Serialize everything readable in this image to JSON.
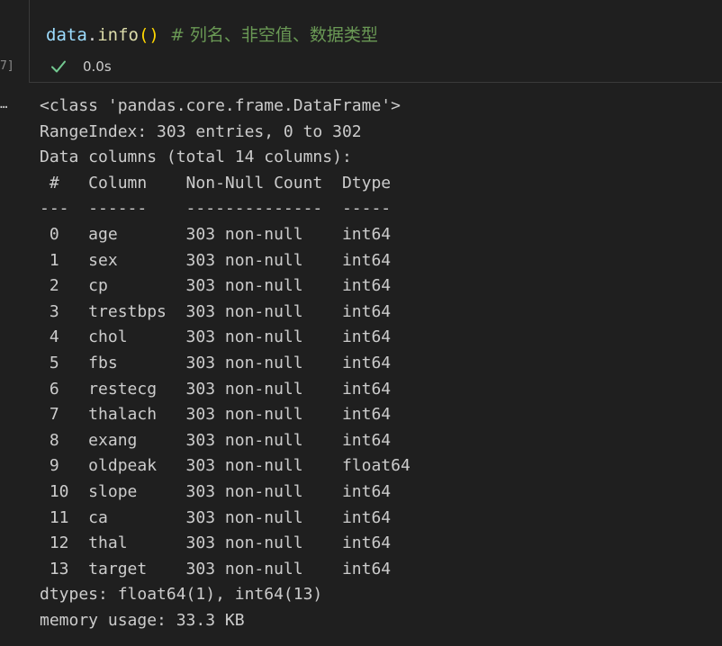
{
  "cell": {
    "execution_count": "7]",
    "code": {
      "var": "data",
      "dot": ".",
      "fn": "info",
      "parens": "()",
      "comment": "  # 列名、非空值、数据类型"
    },
    "status": {
      "icon": "check-icon",
      "duration": "0.0s",
      "success_color": "#73c991"
    }
  },
  "output": {
    "marker": "…",
    "lines": [
      "<class 'pandas.core.frame.DataFrame'>",
      "RangeIndex: 303 entries, 0 to 302",
      "Data columns (total 14 columns):",
      " #   Column    Non-Null Count  Dtype  ",
      "---  ------    --------------  -----  ",
      " 0   age       303 non-null    int64  ",
      " 1   sex       303 non-null    int64  ",
      " 2   cp        303 non-null    int64  ",
      " 3   trestbps  303 non-null    int64  ",
      " 4   chol      303 non-null    int64  ",
      " 5   fbs       303 non-null    int64  ",
      " 6   restecg   303 non-null    int64  ",
      " 7   thalach   303 non-null    int64  ",
      " 8   exang     303 non-null    int64  ",
      " 9   oldpeak   303 non-null    float64",
      " 10  slope     303 non-null    int64  ",
      " 11  ca        303 non-null    int64  ",
      " 12  thal      303 non-null    int64  ",
      " 13  target    303 non-null    int64  ",
      "dtypes: float64(1), int64(13)",
      "memory usage: 33.3 KB"
    ]
  }
}
